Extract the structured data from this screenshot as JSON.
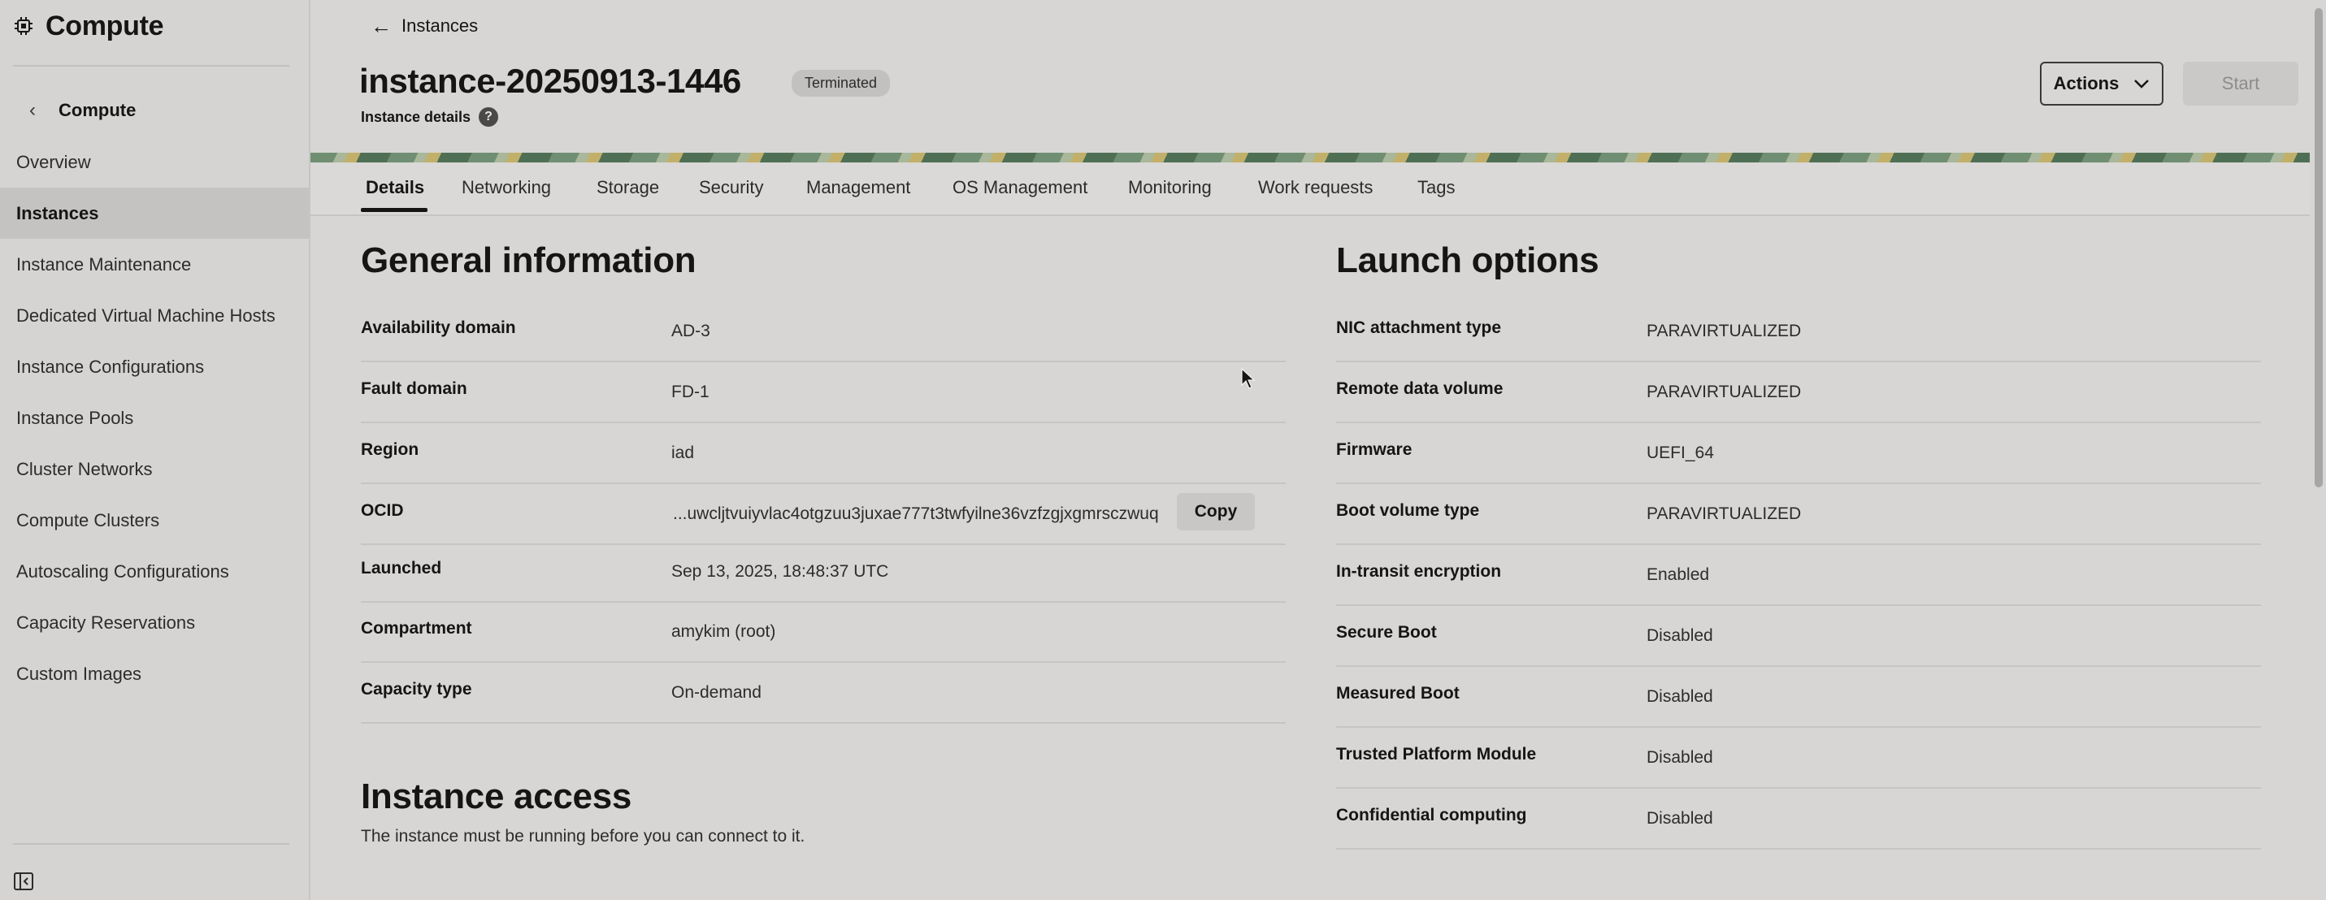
{
  "sidebar": {
    "title": "Compute",
    "back_label": "Compute",
    "items": [
      {
        "label": "Overview",
        "active": false
      },
      {
        "label": "Instances",
        "active": true
      },
      {
        "label": "Instance Maintenance",
        "active": false
      },
      {
        "label": "Dedicated Virtual Machine Hosts",
        "active": false
      },
      {
        "label": "Instance Configurations",
        "active": false
      },
      {
        "label": "Instance Pools",
        "active": false
      },
      {
        "label": "Cluster Networks",
        "active": false
      },
      {
        "label": "Compute Clusters",
        "active": false
      },
      {
        "label": "Autoscaling Configurations",
        "active": false
      },
      {
        "label": "Capacity Reservations",
        "active": false
      },
      {
        "label": "Custom Images",
        "active": false
      }
    ]
  },
  "header": {
    "back_label": "Instances",
    "instance_name": "instance-20250913-1446",
    "status_badge": "Terminated",
    "subtitle": "Instance details",
    "help_glyph": "?",
    "actions_label": "Actions",
    "start_label": "Start"
  },
  "tabs": [
    "Details",
    "Networking",
    "Storage",
    "Security",
    "Management",
    "OS Management",
    "Monitoring",
    "Work requests",
    "Tags"
  ],
  "general": {
    "title": "General information",
    "rows": [
      {
        "key": "Availability domain",
        "value": "AD-3"
      },
      {
        "key": "Fault domain",
        "value": "FD-1"
      },
      {
        "key": "Region",
        "value": "iad"
      },
      {
        "key": "OCID",
        "value": "...uwcljtvuiyvlac4otgzuu3juxae777t3twfyilne36vzfzgjxgmrsczwuq"
      },
      {
        "key": "Launched",
        "value": "Sep 13, 2025, 18:48:37 UTC"
      },
      {
        "key": "Compartment",
        "value": "amykim (root)"
      },
      {
        "key": "Capacity type",
        "value": "On-demand"
      }
    ],
    "copy_label": "Copy"
  },
  "access": {
    "title": "Instance access",
    "description": "The instance must be running before you can connect to it."
  },
  "launch": {
    "title": "Launch options",
    "rows": [
      {
        "key": "NIC attachment type",
        "value": "PARAVIRTUALIZED"
      },
      {
        "key": "Remote data volume",
        "value": "PARAVIRTUALIZED"
      },
      {
        "key": "Firmware",
        "value": "UEFI_64"
      },
      {
        "key": "Boot volume type",
        "value": "PARAVIRTUALIZED"
      },
      {
        "key": "In-transit encryption",
        "value": "Enabled"
      },
      {
        "key": "Secure Boot",
        "value": "Disabled"
      },
      {
        "key": "Measured Boot",
        "value": "Disabled"
      },
      {
        "key": "Trusted Platform Module",
        "value": "Disabled"
      },
      {
        "key": "Confidential computing",
        "value": "Disabled"
      }
    ]
  },
  "icons": {
    "app": "chip-icon",
    "back": "arrow-left-icon",
    "sidebar_back": "chevron-left-icon",
    "help": "help-icon",
    "actions": "chevron-down-icon",
    "collapse": "sidebar-collapse-icon"
  }
}
